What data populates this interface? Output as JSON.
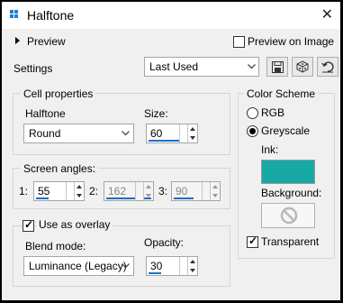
{
  "window": {
    "title": "Halftone",
    "close_glyph": "✕"
  },
  "preview": {
    "label": "Preview",
    "on_image_label": "Preview on Image",
    "on_image_checked": false
  },
  "settings": {
    "label": "Settings",
    "preset_value": "Last Used"
  },
  "cell_properties": {
    "title": "Cell properties",
    "halftone_label": "Halftone",
    "halftone_value": "Round",
    "size_label": "Size:",
    "size_value": "60"
  },
  "screen_angles": {
    "title": "Screen angles:",
    "channels": [
      {
        "label": "1:",
        "value": "55",
        "enabled": true,
        "level": 0.15
      },
      {
        "label": "2:",
        "value": "162",
        "enabled": false,
        "level": 0.45
      },
      {
        "label": "3:",
        "value": "90",
        "enabled": false,
        "level": 0.25
      }
    ]
  },
  "overlay": {
    "use_label": "Use as overlay",
    "use_checked": true,
    "blend_label": "Blend mode:",
    "blend_value": "Luminance (Legacy)",
    "opacity_label": "Opacity:",
    "opacity_value": "30"
  },
  "color_scheme": {
    "title": "Color Scheme",
    "rgb_label": "RGB",
    "greyscale_label": "Greyscale",
    "selected": "Greyscale",
    "ink_label": "Ink:",
    "ink_color": "#17aaa4",
    "background_label": "Background:",
    "transparent_label": "Transparent",
    "transparent_checked": true
  },
  "colors": {
    "accent": "#1e6ec8"
  }
}
